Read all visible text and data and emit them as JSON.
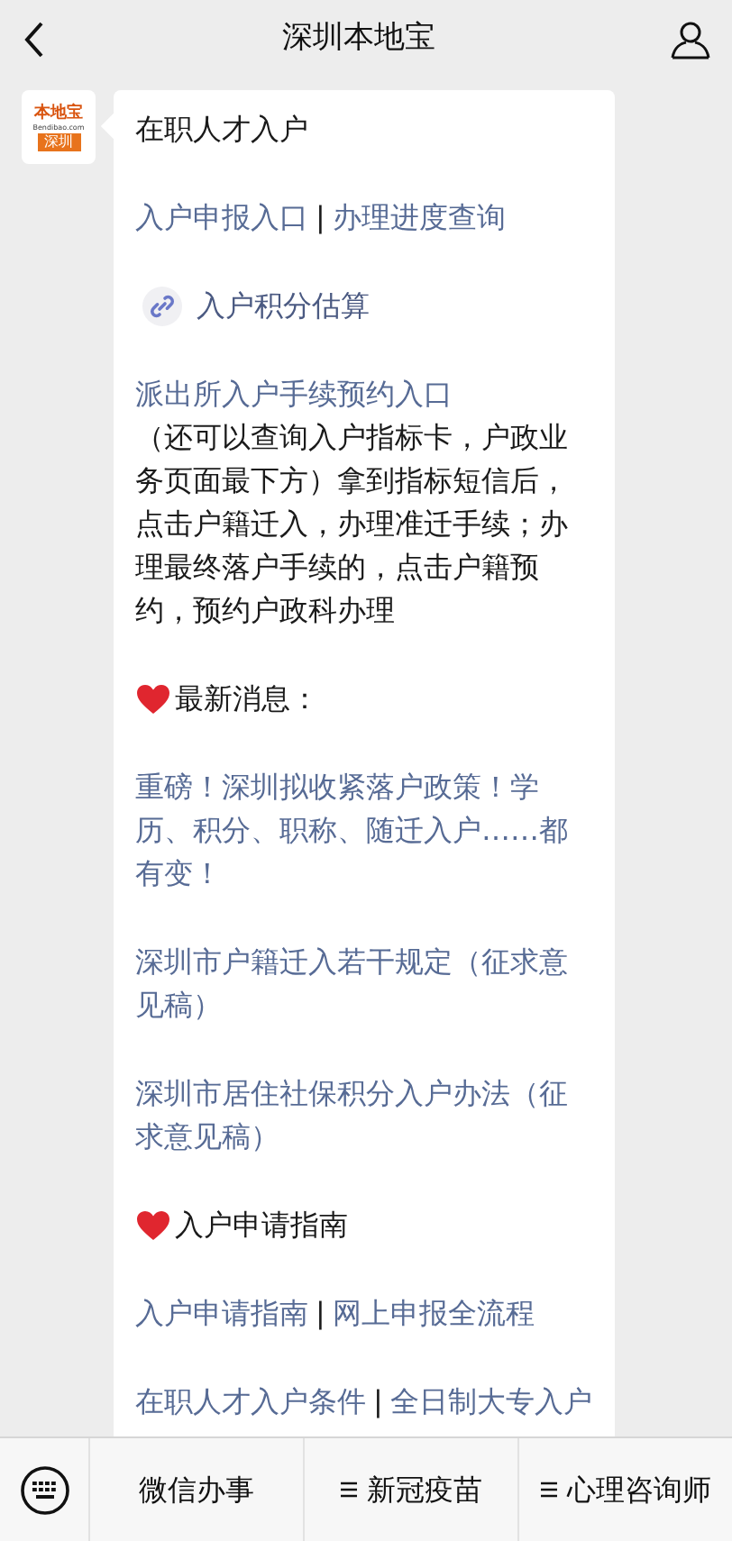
{
  "header": {
    "title": "深圳本地宝"
  },
  "avatar": {
    "brand": "本地宝",
    "domain": "Bendibao.com",
    "city": "深圳"
  },
  "message": [
    {
      "kind": "title",
      "text": "在职人才入户"
    },
    {
      "kind": "links",
      "parts": [
        {
          "kind": "link",
          "text": "入户申报入口"
        },
        {
          "kind": "plain",
          "text": "|"
        },
        {
          "kind": "link",
          "text": "办理进度查询"
        }
      ]
    },
    {
      "kind": "miniprogram",
      "text": "入户积分估算"
    },
    {
      "kind": "paragraph",
      "link": "派出所入户手续预约入口",
      "text": "（还可以查询入户指标卡，户政业务页面最下方）拿到指标短信后，点击户籍迁入，办理准迁手续；办理最终落户手续的，点击户籍预约，预约户政科办理"
    },
    {
      "kind": "heading",
      "text": "最新消息："
    },
    {
      "kind": "link",
      "text": "重磅！深圳拟收紧落户政策！学历、积分、职称、随迁入户……都有变！"
    },
    {
      "kind": "link",
      "text": "深圳市户籍迁入若干规定（征求意见稿）"
    },
    {
      "kind": "link",
      "text": "深圳市居住社保积分入户办法（征求意见稿）"
    },
    {
      "kind": "heading",
      "text": "入户申请指南"
    },
    {
      "kind": "links",
      "parts": [
        {
          "kind": "link",
          "text": "入户申请指南"
        },
        {
          "kind": "plain",
          "text": "|"
        },
        {
          "kind": "link",
          "text": "网上申报全流程"
        }
      ]
    },
    {
      "kind": "links",
      "parts": [
        {
          "kind": "link",
          "text": "在职人才入户条件"
        },
        {
          "kind": "plain",
          "text": "|"
        },
        {
          "kind": "link",
          "text": "全日制大专入户"
        }
      ]
    }
  ],
  "menu": [
    {
      "label": "微信办事",
      "has_submenu": false
    },
    {
      "label": "新冠疫苗",
      "has_submenu": true
    },
    {
      "label": "心理咨询师",
      "has_submenu": true
    }
  ]
}
